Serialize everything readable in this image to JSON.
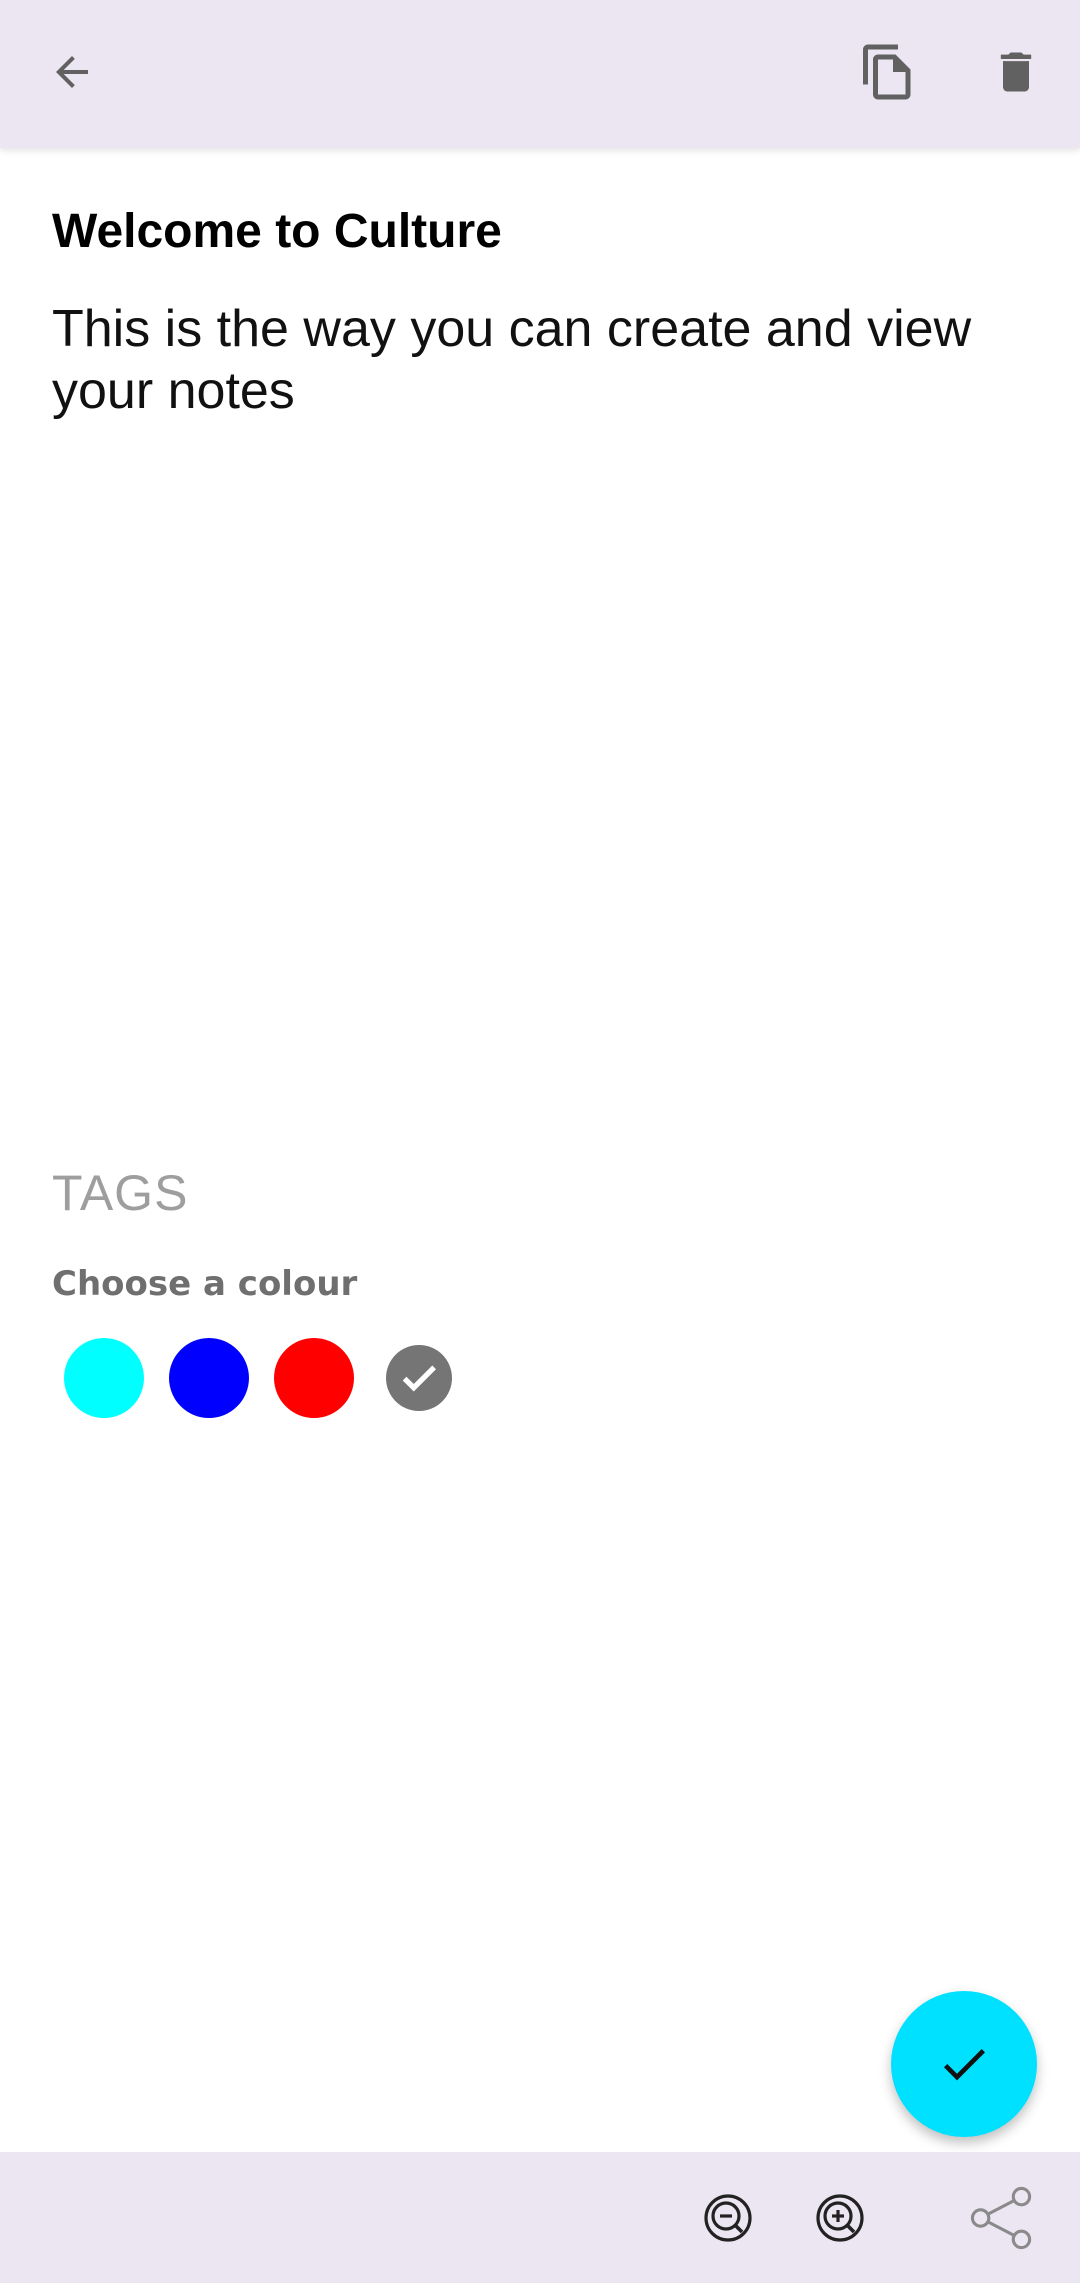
{
  "app": {
    "colors": {
      "bar_background": "#ece6f3",
      "icon": "#616161",
      "fab": "#00e0ff"
    }
  },
  "top_bar": {
    "back_icon": "arrow-back-icon",
    "copy_icon": "copy-icon",
    "delete_icon": "delete-icon"
  },
  "note": {
    "title": "Welcome to Culture",
    "body": "This is the way you can create and view your notes"
  },
  "tags": {
    "placeholder": "TAGS"
  },
  "colour_picker": {
    "label": "Choose a colour",
    "swatches": [
      {
        "color": "#00ffff",
        "selected": false
      },
      {
        "color": "#0000ff",
        "selected": false
      },
      {
        "color": "#ff0000",
        "selected": false
      },
      {
        "color": "#757575",
        "selected": true
      }
    ]
  },
  "fab": {
    "icon": "check-icon"
  },
  "bottom_bar": {
    "zoom_out_icon": "zoom-out-icon",
    "zoom_in_icon": "zoom-in-icon",
    "share_icon": "share-icon"
  }
}
